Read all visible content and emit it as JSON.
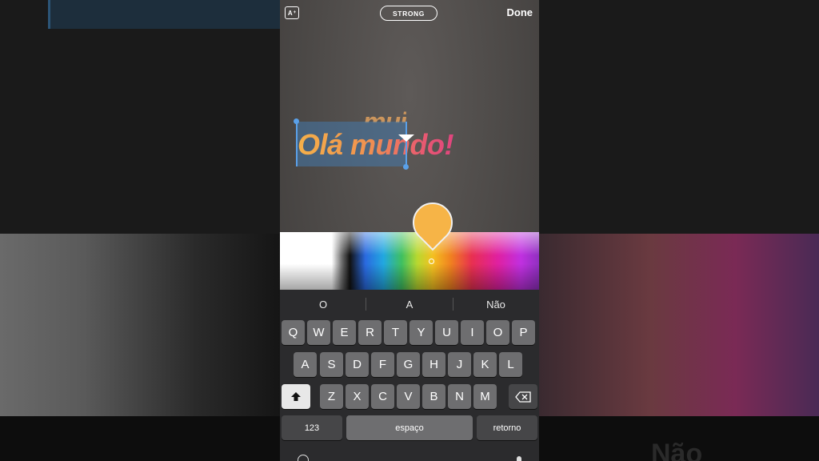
{
  "topbar": {
    "font_size_icon": "A",
    "style_label": "STRONG",
    "done_label": "Done"
  },
  "canvas": {
    "ghost_text": "mui",
    "main_text": "Olá mundo!",
    "text_gradient": [
      "#f4b049",
      "#e0457e"
    ]
  },
  "color_picker": {
    "selected_color": "#f6b447"
  },
  "keyboard": {
    "suggestions": [
      "O",
      "A",
      "Não"
    ],
    "row1": [
      "Q",
      "W",
      "E",
      "R",
      "T",
      "Y",
      "U",
      "I",
      "O",
      "P"
    ],
    "row2": [
      "A",
      "S",
      "D",
      "F",
      "G",
      "H",
      "J",
      "K",
      "L"
    ],
    "row3": [
      "Z",
      "X",
      "C",
      "V",
      "B",
      "N",
      "M"
    ],
    "shift_icon": "shift-icon",
    "backspace_icon": "backspace-icon",
    "numbers_label": "123",
    "space_label": "espaço",
    "return_label": "retorno",
    "globe_icon": "globe-icon",
    "mic_icon": "mic-icon"
  },
  "background": {
    "ghost_text": "Não"
  }
}
